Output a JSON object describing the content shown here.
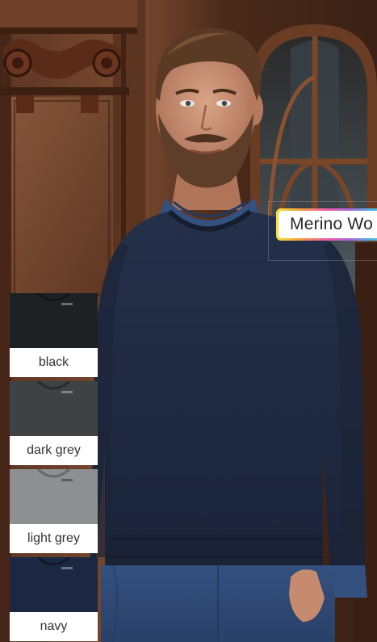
{
  "badge": {
    "text": "Merino Wo",
    "background": "#ffffff",
    "text_color": "#2a2a2a"
  },
  "swatches": [
    {
      "label": "black",
      "color": "#1e2123"
    },
    {
      "label": "dark grey",
      "color": "#3f4245"
    },
    {
      "label": "light grey",
      "color": "#8e8f90"
    },
    {
      "label": "navy",
      "color": "#1c2743"
    }
  ]
}
